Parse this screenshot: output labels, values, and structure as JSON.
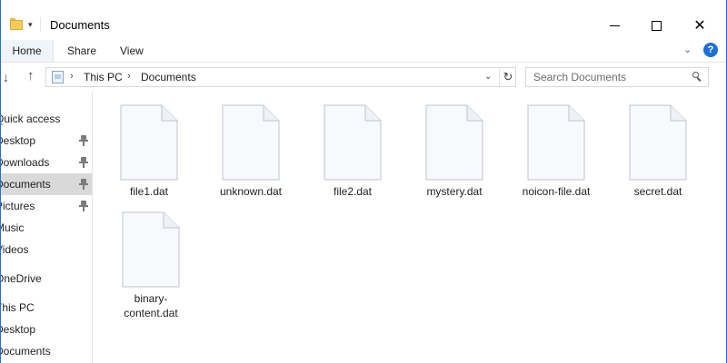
{
  "window": {
    "title": "Documents",
    "quick_access_dropdown": "▾",
    "minimize_label": "",
    "maximize_label": "",
    "close_label": "✕"
  },
  "ribbon": {
    "tabs": [
      {
        "label": "Home"
      },
      {
        "label": "Share"
      },
      {
        "label": "View"
      }
    ],
    "expand_glyph": "⌄",
    "help_glyph": "?"
  },
  "address": {
    "back_glyph": "↓",
    "up_glyph": "↑",
    "separator": "›",
    "crumbs": [
      "This PC",
      "Documents"
    ],
    "dropdown_glyph": "⌄",
    "refresh_glyph": "↻"
  },
  "search": {
    "placeholder": "Search Documents"
  },
  "sidebar": {
    "items": [
      {
        "label": "Quick access",
        "pinned": false
      },
      {
        "label": "Desktop",
        "pinned": true
      },
      {
        "label": "Downloads",
        "pinned": true
      },
      {
        "label": "Documents",
        "pinned": true,
        "state": "selected"
      },
      {
        "label": "Pictures",
        "pinned": true
      },
      {
        "label": "Music",
        "pinned": false
      },
      {
        "label": "Videos",
        "pinned": false
      },
      {
        "label": "OneDrive",
        "pinned": false
      },
      {
        "label": "This PC",
        "pinned": false
      },
      {
        "label": "Desktop",
        "pinned": false
      },
      {
        "label": "Documents",
        "pinned": false
      }
    ]
  },
  "files": [
    {
      "name": "file1.dat",
      "icon": "blank-document-icon"
    },
    {
      "name": "unknown.dat",
      "icon": "blank-document-icon"
    },
    {
      "name": "file2.dat",
      "icon": "blank-document-icon"
    },
    {
      "name": "mystery.dat",
      "icon": "blank-document-icon"
    },
    {
      "name": "noicon-file.dat",
      "icon": "blank-document-icon"
    },
    {
      "name": "secret.dat",
      "icon": "blank-document-icon"
    },
    {
      "name": "binary-content.dat",
      "icon": "blank-document-icon"
    }
  ],
  "colors": {
    "accent": "#1e6fd1",
    "selection": "#cce8ff",
    "window_border": "#2b6cd6"
  }
}
